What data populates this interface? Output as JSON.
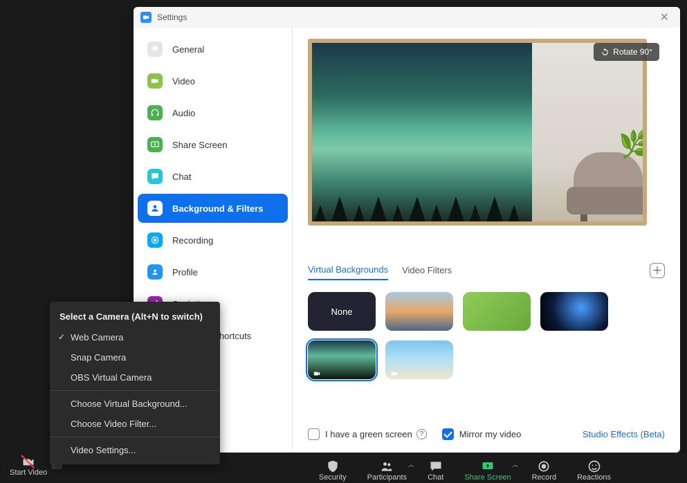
{
  "titlebar": {
    "title": "Settings"
  },
  "sidebar": {
    "items": [
      {
        "label": "General"
      },
      {
        "label": "Video"
      },
      {
        "label": "Audio"
      },
      {
        "label": "Share Screen"
      },
      {
        "label": "Chat"
      },
      {
        "label": "Background & Filters"
      },
      {
        "label": "Recording"
      },
      {
        "label": "Profile"
      },
      {
        "label": "Statistics"
      },
      {
        "label": "Keyboard Shortcuts"
      }
    ]
  },
  "preview": {
    "rotate_label": "Rotate 90°"
  },
  "tabs": {
    "virtual_backgrounds": "Virtual Backgrounds",
    "video_filters": "Video Filters"
  },
  "backgrounds": {
    "none_label": "None"
  },
  "options": {
    "green_screen": "I have a green screen",
    "mirror": "Mirror my video",
    "studio_effects": "Studio Effects (Beta)"
  },
  "camera_menu": {
    "heading": "Select a Camera (Alt+N to switch)",
    "cam1": "Web Camera",
    "cam2": "Snap Camera",
    "cam3": "OBS Virtual Camera",
    "choose_bg": "Choose Virtual Background...",
    "choose_filter": "Choose Video Filter...",
    "video_settings": "Video Settings..."
  },
  "toolbar": {
    "start_video": "Start Video",
    "security": "Security",
    "participants": "Participants",
    "chat": "Chat",
    "share_screen": "Share Screen",
    "record": "Record",
    "reactions": "Reactions"
  }
}
